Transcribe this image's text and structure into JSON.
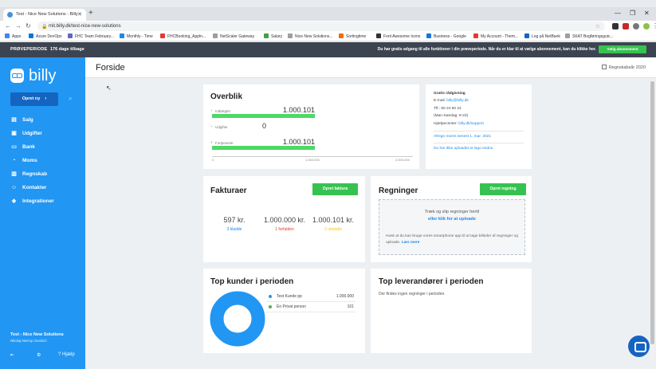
{
  "browser": {
    "tab_title": "Test - Nice New Solutions - Billy",
    "url": "mit.billy.dk/test-nice-new-solutions",
    "bookmarks": [
      {
        "label": "Apps",
        "color": "#4285f4"
      },
      {
        "label": "Azure DevOps",
        "color": "#0078d4"
      },
      {
        "label": "FHC Team February...",
        "color": "#5c6bc0"
      },
      {
        "label": "Monthly - Time",
        "color": "#1e88e5"
      },
      {
        "label": "FHCBooking_Appln...",
        "color": "#e53935"
      },
      {
        "label": "NetScaler Gateway",
        "color": "#9e9e9e"
      },
      {
        "label": "Salary",
        "color": "#43a047"
      },
      {
        "label": "Nice New Solutions...",
        "color": "#9e9e9e"
      },
      {
        "label": "Sortingtime",
        "color": "#ef6c00"
      },
      {
        "label": "Font Awesome Icons",
        "color": "#333333"
      },
      {
        "label": "Business - Google",
        "color": "#1976d2"
      },
      {
        "label": "My Account - Them...",
        "color": "#e53935"
      },
      {
        "label": "Log på NetBank",
        "color": "#1565c0"
      },
      {
        "label": "SKAT Bogføringsguic...",
        "color": "#9e9e9e"
      }
    ]
  },
  "banner": {
    "trial_label": "PRØVEPERIODE",
    "days_left": "176 dage tilbage",
    "message": "Du har gratis adgang til alle funktioner i din prøveperiode. Når du er klar til at vælge abonnement, kan du klikke her.",
    "choose_plan": "Vælg abonnement"
  },
  "sidebar": {
    "logo": "billy",
    "create_button": "Opret ny",
    "items": [
      {
        "label": "Salg",
        "icon": "sales-icon"
      },
      {
        "label": "Udgifter",
        "icon": "expenses-icon"
      },
      {
        "label": "Bank",
        "icon": "bank-icon"
      },
      {
        "label": "Moms",
        "icon": "vat-icon"
      },
      {
        "label": "Regnskab",
        "icon": "accounting-icon"
      },
      {
        "label": "Kontakter",
        "icon": "contacts-icon"
      },
      {
        "label": "Integrationer",
        "icon": "integrations-icon"
      }
    ],
    "company_name": "Test - Nice New Solutions",
    "user_name": "Nikolaj Nørrup Svalsch",
    "help_label": "Hjælp"
  },
  "header": {
    "title": "Forside",
    "fiscal_year": "Regnskabsår 2020"
  },
  "overview": {
    "title": "Overblik",
    "rows": [
      {
        "label": "Indtægter",
        "value": "1.000.101",
        "fill": 1.0,
        "color": "#4cd964"
      },
      {
        "label": "Udgifter",
        "value": "0",
        "fill": 0.0,
        "color": "#e57373"
      },
      {
        "label": "Fortjeneste",
        "value": "1.000.101",
        "fill": 1.0,
        "color": "#4cd964"
      }
    ],
    "ticks": [
      "0",
      "1.000.000",
      "2.000.000"
    ]
  },
  "help_panel": {
    "title": "Gratis rådgivning",
    "email_label": "E-mail:",
    "email": "billy@billy.dk",
    "phone": "Tlf.: 60 24 60 24",
    "hours": "(Man-Søndag: 8-23)",
    "helpcenter_label": "Hjælpecenter:",
    "helpcenter": "billy.dk/support",
    "vat_deadline": "Afregn moms senest 1. mar. 2021",
    "logo_notice": "Du har ikke uploadet et logo endnu"
  },
  "invoices": {
    "title": "Fakturaer",
    "create_button": "Opret faktura",
    "stats": [
      {
        "value": "597 kr.",
        "label": "3 kladde",
        "color": "#1e88e5"
      },
      {
        "value": "1.000.000 kr.",
        "label": "1 forfalden",
        "color": "#e53935"
      },
      {
        "value": "1.000.101 kr.",
        "label": "2 ubetalte",
        "color": "#f9c80e"
      }
    ]
  },
  "bills": {
    "title": "Regninger",
    "create_button": "Opret regning",
    "drop_text": "Træk og slip regninger hertil",
    "drop_link": "eller klik for at uploade",
    "hint": "Husk at du kan bruge vores smartphone app til at tage billeder af regninger og uploade.",
    "hint_link": "Læs mere"
  },
  "top_customers": {
    "title": "Top kunder i perioden",
    "items": [
      {
        "name": "Test Kunde pp",
        "value": "1.000.000",
        "color": "#2196f3"
      },
      {
        "name": "En Privat person",
        "value": "101",
        "color": "#4caf50"
      }
    ]
  },
  "top_suppliers": {
    "title": "Top leverandører i perioden",
    "empty": "Der findes ingen regninger i perioden."
  }
}
